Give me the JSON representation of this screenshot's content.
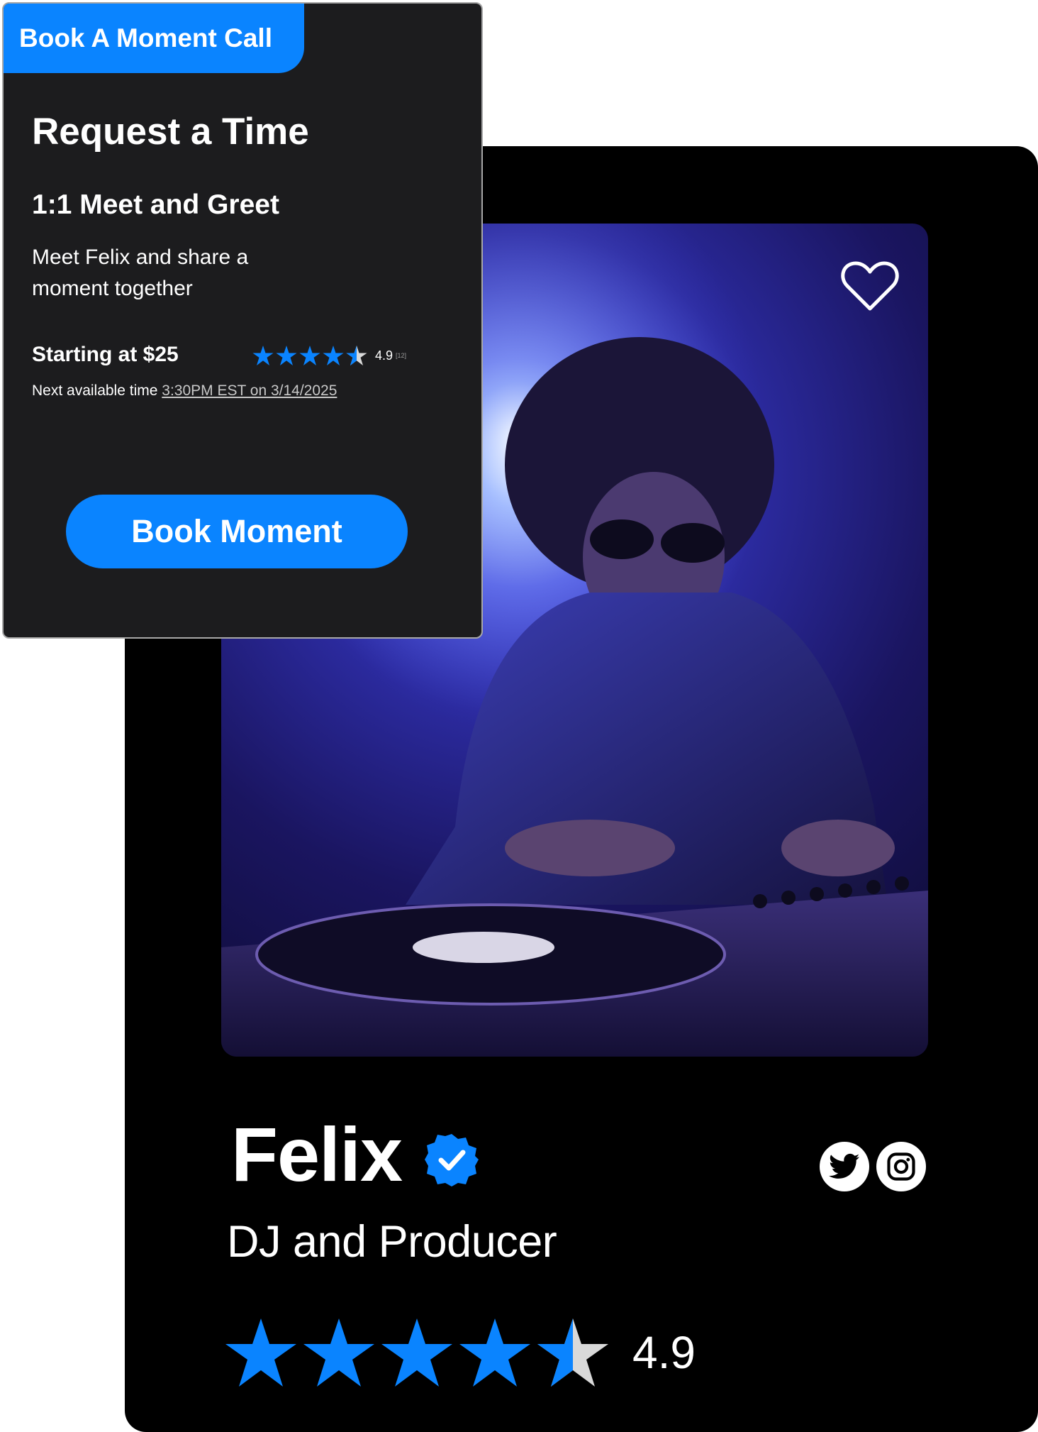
{
  "booking": {
    "tab_label": "Book A Moment Call",
    "title": "Request a Time",
    "subtitle": "1:1 Meet and Greet",
    "description": "Meet Felix and share a moment together",
    "price_label": "Starting at $25",
    "rating": {
      "value": "4.9",
      "count": "[12]",
      "stars": 4.5
    },
    "next_available_prefix": "Next available time",
    "next_available_time": "3:30PM EST on 3/14/2025",
    "button_label": "Book Moment"
  },
  "profile": {
    "name": "Felix",
    "verified": true,
    "role": "DJ and Producer",
    "rating": {
      "value": "4.9",
      "stars": 4.5
    },
    "favorite_icon": "heart-icon",
    "social": [
      "twitter-icon",
      "instagram-icon"
    ],
    "photo_description_icon": "dj-photo"
  },
  "colors": {
    "accent": "#0a84ff",
    "card_dark": "#1c1c1e",
    "profile_bg": "#000000",
    "star_empty": "#d9d9d9"
  }
}
